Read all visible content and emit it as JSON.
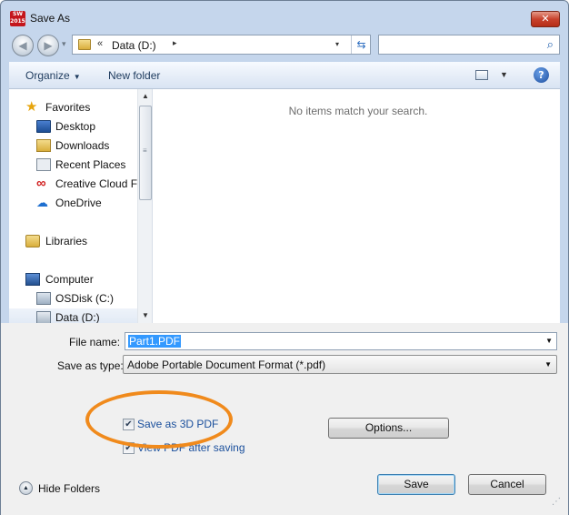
{
  "window": {
    "title": "Save As",
    "app_icon_text": "SW 2015",
    "close_glyph": "✕"
  },
  "nav": {
    "back_icon": "arrow-left-icon",
    "forward_icon": "arrow-right-icon",
    "address": {
      "breadcrumb_overflow": "«",
      "location": "Data (D:)",
      "separator": "▸",
      "dropdown_glyph": "▾",
      "refresh_glyph": "⇆"
    },
    "search": {
      "placeholder": "",
      "icon": "search-icon"
    }
  },
  "toolbar": {
    "organize_label": "Organize",
    "organize_arrow": "▼",
    "new_folder_label": "New folder",
    "view_dropdown_glyph": "▼",
    "help_glyph": "?"
  },
  "sidebar": {
    "favorites": "Favorites",
    "items": [
      {
        "label": "Desktop",
        "icon": "desktop-icon"
      },
      {
        "label": "Downloads",
        "icon": "downloads-icon"
      },
      {
        "label": "Recent Places",
        "icon": "recent-places-icon"
      },
      {
        "label": "Creative Cloud Fi",
        "icon": "creative-cloud-icon"
      },
      {
        "label": "OneDrive",
        "icon": "onedrive-icon"
      }
    ],
    "libraries": "Libraries",
    "computer": "Computer",
    "drives": [
      {
        "label": "OSDisk (C:)",
        "icon": "os-disk-icon"
      },
      {
        "label": "Data (D:)",
        "icon": "data-drive-icon"
      }
    ]
  },
  "filelist": {
    "empty_message": "No items match your search."
  },
  "form": {
    "file_name_label": "File name:",
    "file_name_value": "Part1.PDF",
    "save_as_type_label": "Save as type:",
    "save_as_type_value": "Adobe Portable Document Format (*.pdf)",
    "options": [
      {
        "label": "Save as 3D PDF",
        "checked": true
      },
      {
        "label": "View PDF after saving",
        "checked": true
      }
    ],
    "options_button": "Options...",
    "hide_folders_label": "Hide Folders",
    "save_button": "Save",
    "cancel_button": "Cancel",
    "highlight_color": "#f08a1c"
  }
}
